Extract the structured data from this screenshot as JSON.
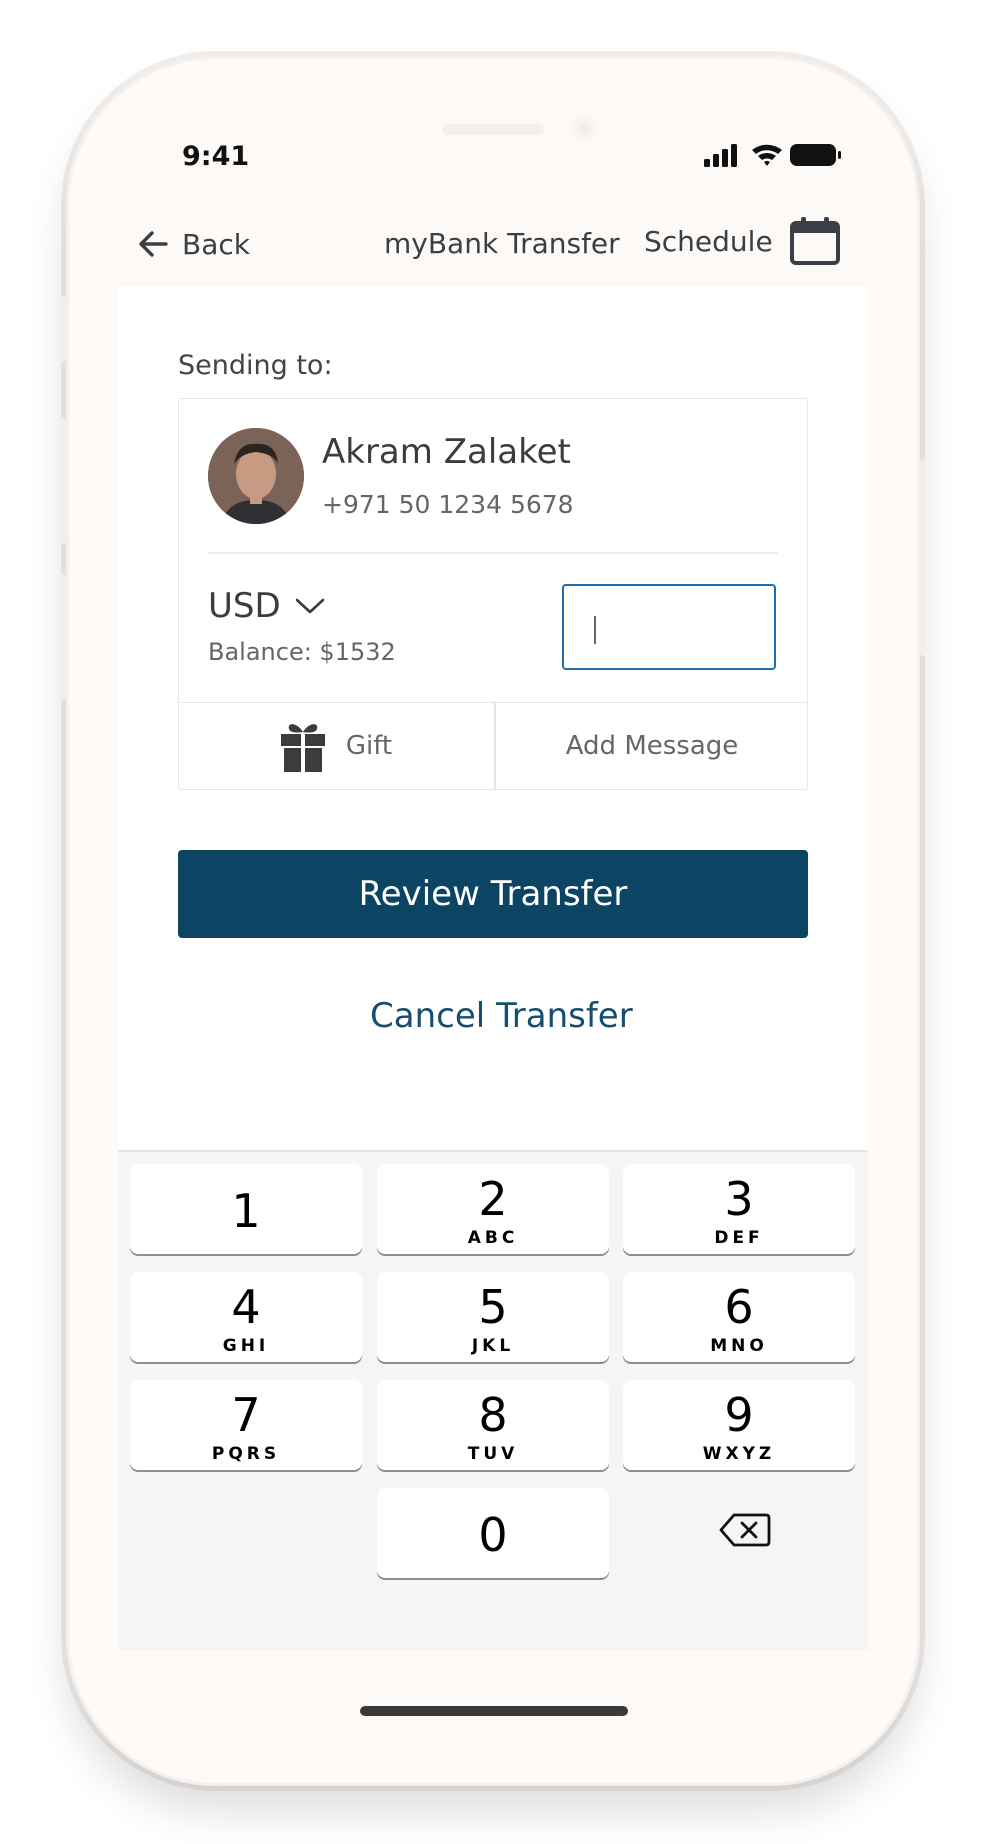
{
  "status_bar": {
    "time": "9:41"
  },
  "nav": {
    "back_label": "Back",
    "title": "myBank Transfer",
    "schedule_label": "Schedule"
  },
  "transfer": {
    "sending_to_label": "Sending to:",
    "recipient": {
      "name": "Akram Zalaket",
      "phone": "+971 50 1234 5678"
    },
    "currency": "USD",
    "balance": "Balance: $1532",
    "amount_value": "",
    "gift_label": "Gift",
    "add_message_label": "Add Message"
  },
  "actions": {
    "review_label": "Review Transfer",
    "cancel_label": "Cancel Transfer"
  },
  "keypad": {
    "keys": [
      {
        "digit": "1",
        "letters": ""
      },
      {
        "digit": "2",
        "letters": "ABC"
      },
      {
        "digit": "3",
        "letters": "DEF"
      },
      {
        "digit": "4",
        "letters": "GHI"
      },
      {
        "digit": "5",
        "letters": "JKL"
      },
      {
        "digit": "6",
        "letters": "MNO"
      },
      {
        "digit": "7",
        "letters": "PQRS"
      },
      {
        "digit": "8",
        "letters": "TUV"
      },
      {
        "digit": "9",
        "letters": "WXYZ"
      },
      {
        "digit": "0",
        "letters": ""
      }
    ]
  },
  "colors": {
    "primary_button": "#0c4464",
    "link": "#154e6e",
    "input_focus": "#1f6fae"
  }
}
